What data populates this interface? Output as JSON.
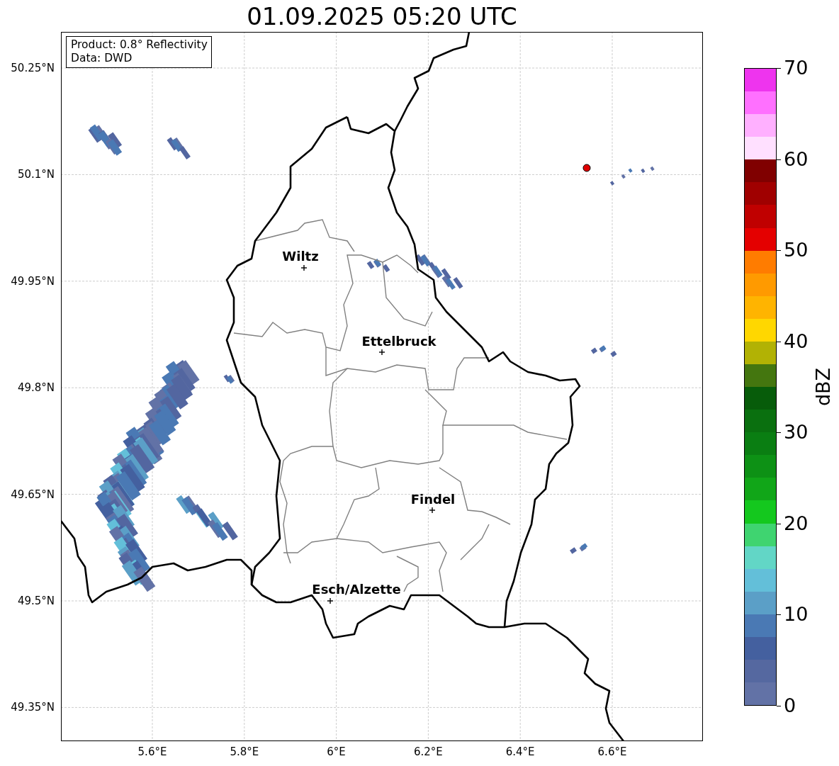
{
  "title": "01.09.2025 05:20 UTC",
  "info_box": {
    "lines": [
      "Product: 0.8° Reflectivity",
      "Data: DWD"
    ]
  },
  "cities": [
    {
      "name": "Wiltz"
    },
    {
      "name": "Ettelbruck"
    },
    {
      "name": "Findel"
    },
    {
      "name": "Esch/Alzette"
    }
  ],
  "x_ticks": [
    "5.6°E",
    "5.8°E",
    "6°E",
    "6.2°E",
    "6.4°E",
    "6.6°E"
  ],
  "y_ticks": [
    "50.25°N",
    "50.1°N",
    "49.95°N",
    "49.8°N",
    "49.65°N",
    "49.5°N",
    "49.35°N"
  ],
  "colorbar": {
    "label": "dBZ",
    "ticks": [
      "70",
      "60",
      "50",
      "40",
      "30",
      "20",
      "10",
      "0"
    ],
    "segments": [
      {
        "color": "#ee34ee"
      },
      {
        "color": "#ff70ff"
      },
      {
        "color": "#ffb0ff"
      },
      {
        "color": "#ffe0ff"
      },
      {
        "color": "#800000"
      },
      {
        "color": "#a00000"
      },
      {
        "color": "#c00000"
      },
      {
        "color": "#e40000"
      },
      {
        "color": "#ff7c00"
      },
      {
        "color": "#ff9a00"
      },
      {
        "color": "#ffb400"
      },
      {
        "color": "#ffd700"
      },
      {
        "color": "#b2b204"
      },
      {
        "color": "#44760f"
      },
      {
        "color": "#075c0a"
      },
      {
        "color": "#0a700f"
      },
      {
        "color": "#0a7e12"
      },
      {
        "color": "#0d9115"
      },
      {
        "color": "#11a618"
      },
      {
        "color": "#14c81e"
      },
      {
        "color": "#3fd470"
      },
      {
        "color": "#62d6c6"
      },
      {
        "color": "#63bfd9"
      },
      {
        "color": "#5b9fc7"
      },
      {
        "color": "#4a79b4"
      },
      {
        "color": "#44609f"
      },
      {
        "color": "#5568a0"
      },
      {
        "color": "#6272a6"
      }
    ]
  }
}
